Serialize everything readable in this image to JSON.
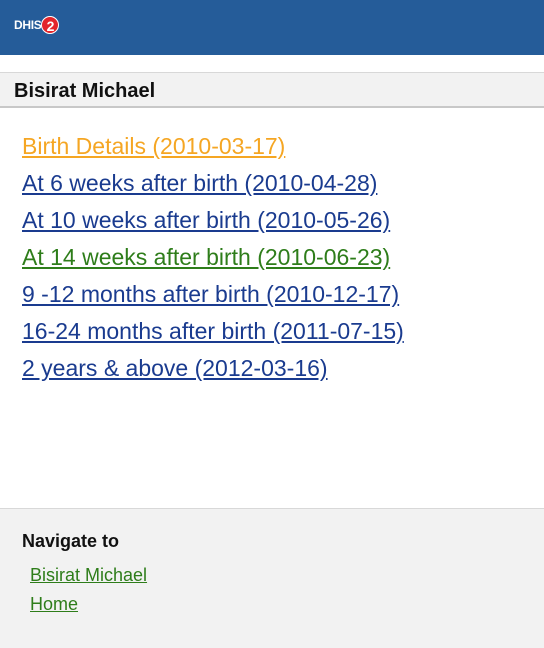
{
  "header": {
    "logo_text": "DHIS",
    "logo_badge": "2",
    "color": "#255c99"
  },
  "patient": {
    "name": "Bisirat Michael"
  },
  "stages": [
    {
      "label": "Birth Details (2010-03-17)",
      "color": "#f5a623"
    },
    {
      "label": "At 6 weeks after birth (2010-04-28)",
      "color": "#1a3b8f"
    },
    {
      "label": "At 10 weeks after birth (2010-05-26)",
      "color": "#1a3b8f"
    },
    {
      "label": "At 14 weeks after birth (2010-06-23)",
      "color": "#2e7d1a"
    },
    {
      "label": "9 -12 months after birth (2010-12-17)",
      "color": "#1a3b8f"
    },
    {
      "label": "16-24 months after birth (2011-07-15)",
      "color": "#1a3b8f"
    },
    {
      "label": "2 years & above (2012-03-16)",
      "color": "#1a3b8f"
    }
  ],
  "navigate": {
    "title": "Navigate to",
    "links": [
      {
        "label": "Bisirat Michael",
        "color": "#2e7d1a"
      },
      {
        "label": "Home",
        "color": "#2e7d1a"
      }
    ]
  }
}
